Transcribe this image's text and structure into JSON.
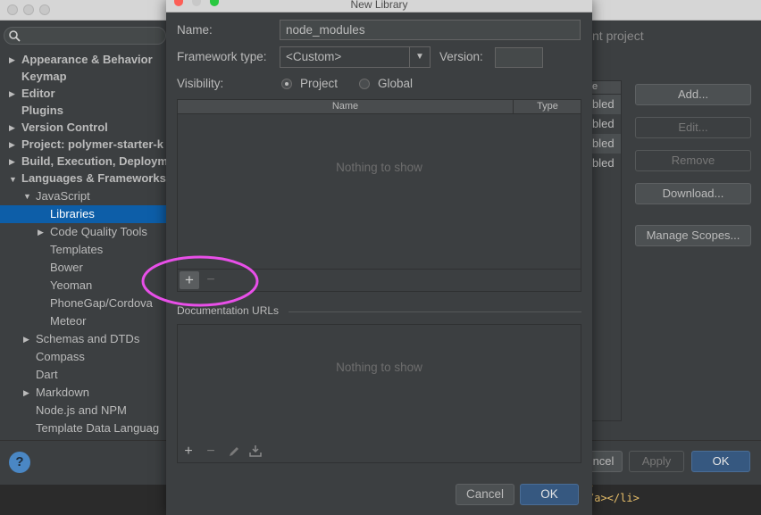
{
  "sidebar": {
    "search_placeholder": "",
    "items": [
      {
        "label": "Appearance & Behavior"
      },
      {
        "label": "Keymap"
      },
      {
        "label": "Editor"
      },
      {
        "label": "Plugins"
      },
      {
        "label": "Version Control"
      },
      {
        "label": "Project: polymer-starter-k"
      },
      {
        "label": "Build, Execution, Deploym"
      },
      {
        "label": "Languages & Frameworks"
      },
      {
        "label": "JavaScript"
      },
      {
        "label": "Libraries"
      },
      {
        "label": "Code Quality Tools"
      },
      {
        "label": "Templates"
      },
      {
        "label": "Bower"
      },
      {
        "label": "Yeoman"
      },
      {
        "label": "PhoneGap/Cordova"
      },
      {
        "label": "Meteor"
      },
      {
        "label": "Schemas and DTDs"
      },
      {
        "label": "Compass"
      },
      {
        "label": "Dart"
      },
      {
        "label": "Markdown"
      },
      {
        "label": "Node.js and NPM"
      },
      {
        "label": "Template Data Languag"
      }
    ]
  },
  "right": {
    "header_fragment": "nt project",
    "col_fragment": "e",
    "rows": [
      "bled",
      "bled",
      "bled",
      "bled"
    ],
    "add_label": "Add...",
    "edit_label": "Edit...",
    "remove_label": "Remove",
    "download_label": "Download...",
    "manage_scopes_label": "Manage Scopes...",
    "cancel_fragment": "ncel",
    "apply_label": "Apply",
    "ok_label": "OK",
    "editor_snippet": "/a></li>"
  },
  "dialog": {
    "title": "New Library",
    "name_label": "Name:",
    "name_value": "node_modules",
    "framework_label": "Framework type:",
    "framework_value": "<Custom>",
    "version_label": "Version:",
    "version_value": "",
    "visibility_label": "Visibility:",
    "visibility_options": [
      "Project",
      "Global"
    ],
    "visibility_selected": "Project",
    "table_headers": [
      "Name",
      "Type"
    ],
    "empty_text": "Nothing to show",
    "doc_urls_label": "Documentation URLs",
    "doc_empty_text": "Nothing to show",
    "cancel_label": "Cancel",
    "ok_label": "OK"
  },
  "colors": {
    "selection": "#0d5ea8",
    "highlight_circle": "#e84fe8",
    "ok_button": "#365880"
  }
}
